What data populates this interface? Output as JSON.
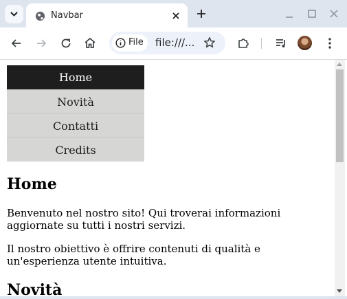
{
  "tab": {
    "title": "Navbar"
  },
  "omnibox": {
    "chip_label": "File",
    "url": "file:///..."
  },
  "nav": {
    "items": [
      {
        "label": "Home",
        "active": true
      },
      {
        "label": "Novità",
        "active": false
      },
      {
        "label": "Contatti",
        "active": false
      },
      {
        "label": "Credits",
        "active": false
      }
    ]
  },
  "content": {
    "heading_home": "Home",
    "paragraph_1": "Benvenuto nel nostro sito! Qui troverai informazioni aggiornate su tutti i nostri servizi.",
    "paragraph_2": "Il nostro obiettivo è offrire contenuti di qualità e un'esperienza utente intuitiva.",
    "heading_novita": "Novità"
  },
  "icons": {
    "tab_favicon": "globe-icon",
    "back": "back-arrow-icon",
    "forward": "forward-arrow-icon",
    "reload": "reload-icon",
    "home": "home-icon",
    "info": "info-icon",
    "bookmark": "star-icon",
    "extensions": "puzzle-icon",
    "media": "media-queue-icon",
    "menu": "kebab-menu-icon"
  },
  "colors": {
    "tabstrip_bg": "#dfe5ee",
    "omnibox_bg": "#edf2fa",
    "nav_active_bg": "#1e1e1e",
    "nav_item_bg": "#d6d6d4"
  }
}
